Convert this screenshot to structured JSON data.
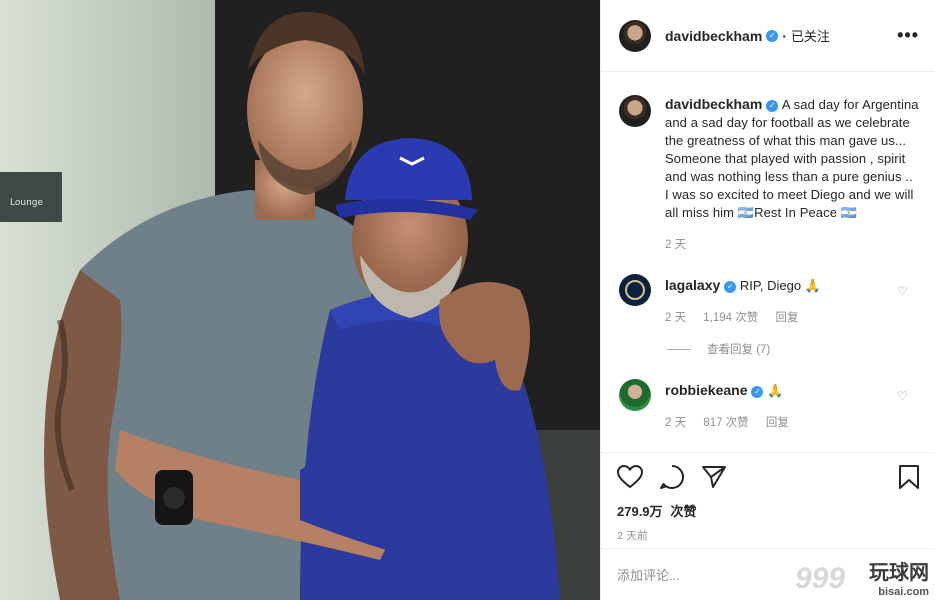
{
  "post": {
    "username": "davidbeckham",
    "follow_status": "已关注",
    "more": "•••"
  },
  "caption": {
    "username": "davidbeckham",
    "text": "A sad day for Argentina and a sad day for football as we celebrate the greatness of what this man gave us... Someone that played with passion , spirit and was nothing less than a pure genius .. I was so excited to meet Diego and we will all miss him 🇦🇷Rest In Peace 🇦🇷",
    "time": "2 天"
  },
  "comments": [
    {
      "username": "lagalaxy",
      "text": "RIP, Diego 🙏",
      "time": "2 天",
      "likes": "1,194 次赞",
      "reply": "回复",
      "view_replies": "查看回复 (7)"
    },
    {
      "username": "robbiekeane",
      "text": "🙏",
      "time": "2 天",
      "likes": "817 次赞",
      "reply": "回复"
    }
  ],
  "stats": {
    "likes_count": "279.9万",
    "likes_label": "次赞",
    "posted": "2 天前"
  },
  "add_comment": {
    "placeholder": "添加评论..."
  },
  "photo_sign": {
    "line1": "Lounge"
  },
  "watermark": {
    "text": "玩球网",
    "sub": "bisai.com",
    "num": "999"
  },
  "colors": {
    "verified": "#3897f0",
    "text": "#262626",
    "muted": "#8e8e8e",
    "border": "#efefef"
  }
}
